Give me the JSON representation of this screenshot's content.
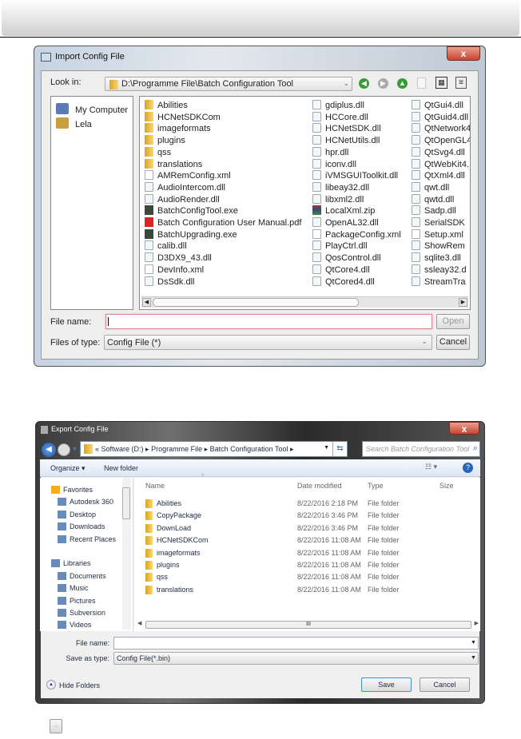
{
  "import_dialog": {
    "title": "Import Config File",
    "close": "x",
    "look_in_label": "Look in:",
    "look_in_path": "D:\\Programme File\\Batch Configuration Tool",
    "sidebar": [
      {
        "label": "My Computer",
        "icon": "computer-icon"
      },
      {
        "label": "Lela",
        "icon": "user-icon"
      }
    ],
    "columns": [
      [
        {
          "n": "Abilities",
          "t": "folder"
        },
        {
          "n": "HCNetSDKCom",
          "t": "folder"
        },
        {
          "n": "imageformats",
          "t": "folder"
        },
        {
          "n": "plugins",
          "t": "folder"
        },
        {
          "n": "qss",
          "t": "folder"
        },
        {
          "n": "translations",
          "t": "folder"
        },
        {
          "n": "AMRemConfig.xml",
          "t": "file"
        },
        {
          "n": "AudioIntercom.dll",
          "t": "dll"
        },
        {
          "n": "AudioRender.dll",
          "t": "dll"
        },
        {
          "n": "BatchConfigTool.exe",
          "t": "exe"
        },
        {
          "n": "Batch Configuration User Manual.pdf",
          "t": "pdf"
        },
        {
          "n": "BatchUpgrading.exe",
          "t": "exe"
        },
        {
          "n": "calib.dll",
          "t": "dll"
        },
        {
          "n": "D3DX9_43.dll",
          "t": "dll"
        },
        {
          "n": "DevInfo.xml",
          "t": "file"
        },
        {
          "n": "DsSdk.dll",
          "t": "dll"
        }
      ],
      [
        {
          "n": "gdiplus.dll",
          "t": "dll"
        },
        {
          "n": "HCCore.dll",
          "t": "dll"
        },
        {
          "n": "HCNetSDK.dll",
          "t": "dll"
        },
        {
          "n": "HCNetUtils.dll",
          "t": "dll"
        },
        {
          "n": "hpr.dll",
          "t": "dll"
        },
        {
          "n": "iconv.dll",
          "t": "dll"
        },
        {
          "n": "iVMSGUIToolkit.dll",
          "t": "dll"
        },
        {
          "n": "libeay32.dll",
          "t": "dll"
        },
        {
          "n": "libxml2.dll",
          "t": "dll"
        },
        {
          "n": "LocalXml.zip",
          "t": "zip"
        },
        {
          "n": "OpenAL32.dll",
          "t": "dll"
        },
        {
          "n": "PackageConfig.xml",
          "t": "file"
        },
        {
          "n": "PlayCtrl.dll",
          "t": "dll"
        },
        {
          "n": "QosControl.dll",
          "t": "dll"
        },
        {
          "n": "QtCore4.dll",
          "t": "dll"
        },
        {
          "n": "QtCored4.dll",
          "t": "dll"
        }
      ],
      [
        {
          "n": "QtGui4.dll",
          "t": "dll"
        },
        {
          "n": "QtGuid4.dll",
          "t": "dll"
        },
        {
          "n": "QtNetwork4",
          "t": "dll"
        },
        {
          "n": "QtOpenGL4",
          "t": "dll"
        },
        {
          "n": "QtSvg4.dll",
          "t": "dll"
        },
        {
          "n": "QtWebKit4.",
          "t": "dll"
        },
        {
          "n": "QtXml4.dll",
          "t": "dll"
        },
        {
          "n": "qwt.dll",
          "t": "dll"
        },
        {
          "n": "qwtd.dll",
          "t": "dll"
        },
        {
          "n": "Sadp.dll",
          "t": "dll"
        },
        {
          "n": "SerialSDK",
          "t": "dll"
        },
        {
          "n": "Setup.xml",
          "t": "file"
        },
        {
          "n": "ShowRem",
          "t": "dll"
        },
        {
          "n": "sqlite3.dll",
          "t": "dll"
        },
        {
          "n": "ssleay32.d",
          "t": "dll"
        },
        {
          "n": "StreamTra",
          "t": "dll"
        }
      ]
    ],
    "file_name_label": "File name:",
    "file_name_value": "",
    "files_of_type_label": "Files of type:",
    "files_of_type_value": "Config File (*)",
    "open": "Open",
    "cancel": "Cancel"
  },
  "export_dialog": {
    "title": "Export Config File",
    "close": "x",
    "breadcrumb": [
      "«",
      "Software (D:)",
      "Programme File",
      "Batch Configuration Tool"
    ],
    "search_placeholder": "Search Batch Configuration Tool",
    "organize": "Organize ▾",
    "new_folder": "New folder",
    "nav": [
      {
        "label": "Favorites",
        "group": true,
        "icon": "star-icon"
      },
      {
        "label": "Autodesk 360",
        "icon": "cloud-icon"
      },
      {
        "label": "Desktop",
        "icon": "desktop-icon"
      },
      {
        "label": "Downloads",
        "icon": "downloads-icon"
      },
      {
        "label": "Recent Places",
        "icon": "recent-places-icon"
      },
      {
        "label": "",
        "spacer": true
      },
      {
        "label": "Libraries",
        "group": true,
        "icon": "libraries-icon"
      },
      {
        "label": "Documents",
        "icon": "documents-icon"
      },
      {
        "label": "Music",
        "icon": "music-icon"
      },
      {
        "label": "Pictures",
        "icon": "pictures-icon"
      },
      {
        "label": "Subversion",
        "icon": "subversion-icon"
      },
      {
        "label": "Videos",
        "icon": "videos-icon"
      }
    ],
    "headers": [
      "Name",
      "Date modified",
      "Type",
      "Size"
    ],
    "rows": [
      [
        "Abilities",
        "8/22/2016 2:18 PM",
        "File folder"
      ],
      [
        "CopyPackage",
        "8/22/2016 3:46 PM",
        "File folder"
      ],
      [
        "DownLoad",
        "8/22/2016 3:46 PM",
        "File folder"
      ],
      [
        "HCNetSDKCom",
        "8/22/2016 11:08 AM",
        "File folder"
      ],
      [
        "imageformats",
        "8/22/2016 11:08 AM",
        "File folder"
      ],
      [
        "plugins",
        "8/22/2016 11:08 AM",
        "File folder"
      ],
      [
        "qss",
        "8/22/2016 11:08 AM",
        "File folder"
      ],
      [
        "translations",
        "8/22/2016 11:08 AM",
        "File folder"
      ]
    ],
    "file_name_label": "File name:",
    "file_name_value": "",
    "save_type_label": "Save as type:",
    "save_type_value": "Config File(*.bin)",
    "hide_folders": "Hide Folders",
    "save": "Save",
    "cancel": "Cancel"
  },
  "browse_button": "..."
}
